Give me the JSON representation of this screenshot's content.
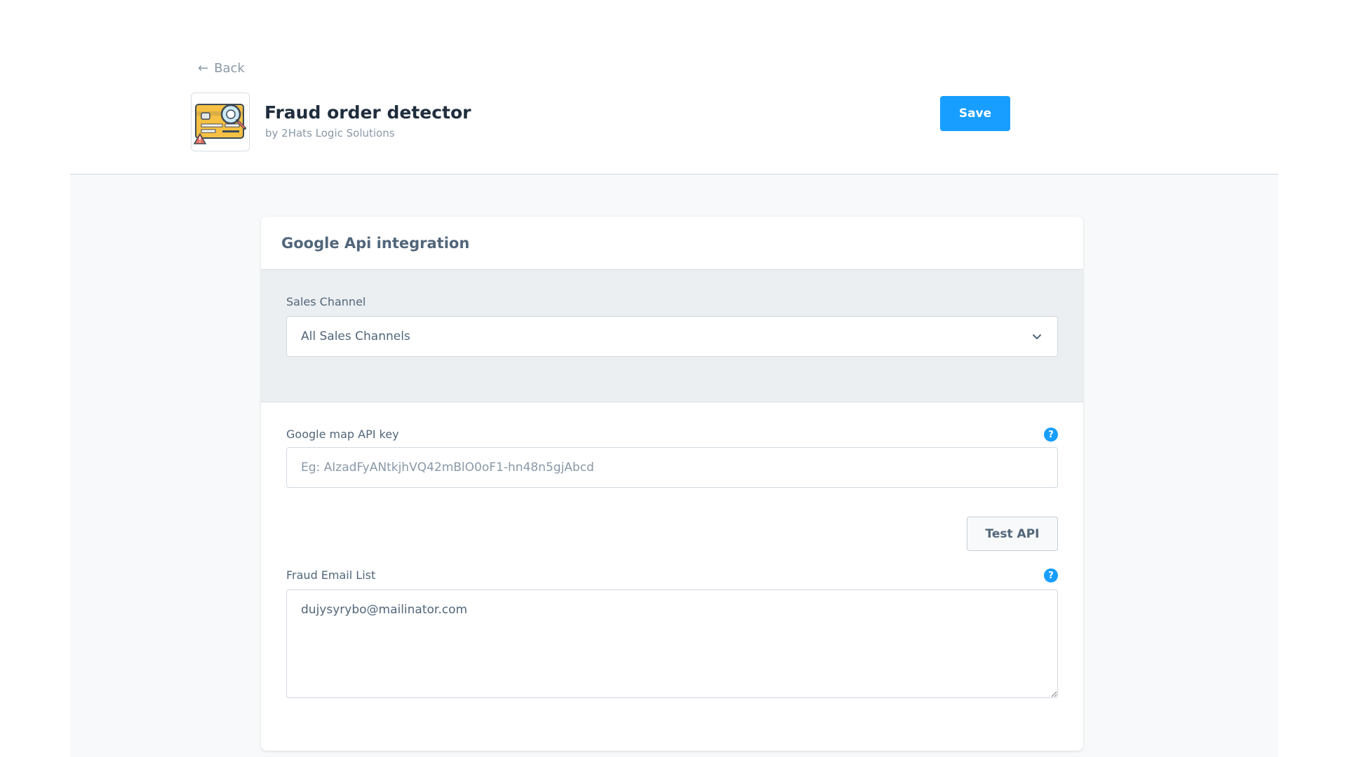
{
  "header": {
    "back_label": "Back",
    "app_title": "Fraud order detector",
    "app_subtitle": "by 2Hats Logic Solutions",
    "app_icon": "credit-card-magnifier-icon",
    "save_label": "Save"
  },
  "card": {
    "title": "Google Api integration",
    "sales_channel": {
      "label": "Sales Channel",
      "selected_value": "All Sales Channels"
    },
    "api_key": {
      "label": "Google map API key",
      "value": "",
      "placeholder": "Eg: AIzadFyANtkjhVQ42mBlO0oF1-hn48n5gjAbcd"
    },
    "test_api_label": "Test API",
    "fraud_email": {
      "label": "Fraud Email List",
      "value": "dujysyrybo@mailinator.com"
    },
    "help_icon_glyph": "?"
  },
  "colors": {
    "accent": "#189eff",
    "page_bg": "#f7f9fa",
    "section_bg": "#ebeff2",
    "text_muted": "#8a99a8",
    "text_label": "#52667a"
  }
}
